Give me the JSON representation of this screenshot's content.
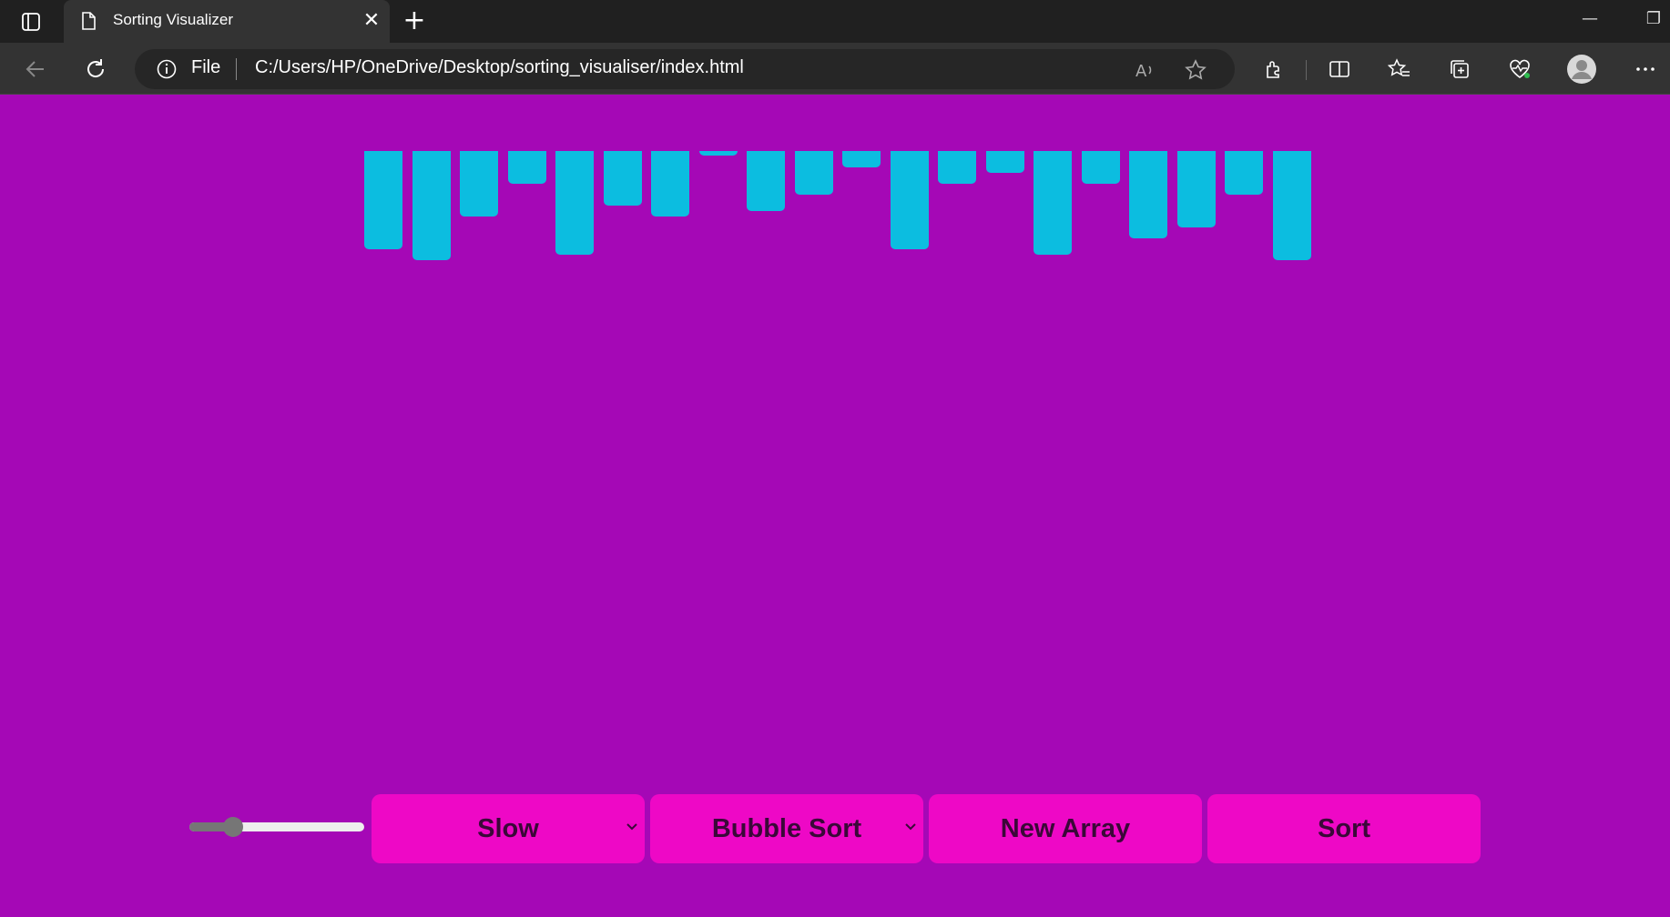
{
  "browser": {
    "tab_title": "Sorting Visualizer",
    "address_scheme": "File",
    "url": "C:/Users/HP/OneDrive/Desktop/sorting_visualiser/index.html"
  },
  "visualizer": {
    "bar_color": "#0cbde0",
    "background": "#a508b6",
    "bar_values": [
      108,
      120,
      72,
      36,
      114,
      60,
      72,
      5,
      66,
      48,
      18,
      108,
      36,
      24,
      114,
      36,
      96,
      84,
      48,
      120
    ]
  },
  "controls": {
    "speed_slider_value": 0.25,
    "speed_select": "Slow",
    "algorithm_select": "Bubble Sort",
    "new_array_label": "New Array",
    "sort_label": "Sort",
    "accent_color": "#ee08c6"
  }
}
